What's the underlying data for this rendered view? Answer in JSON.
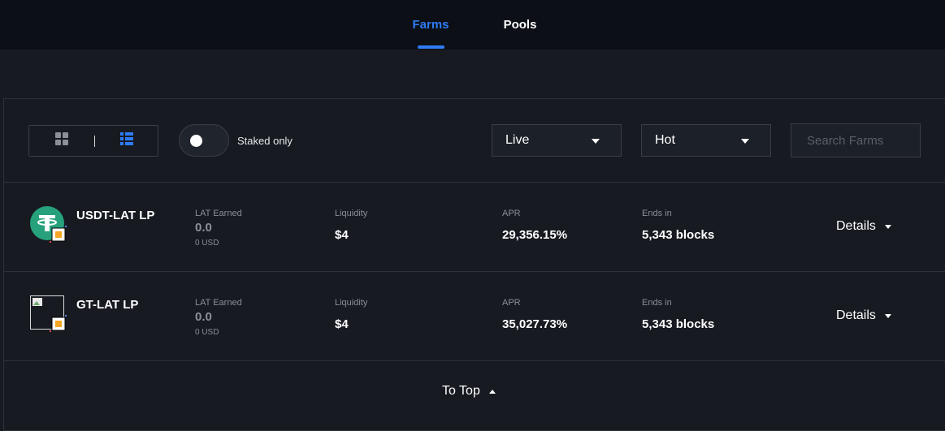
{
  "tabs": [
    {
      "label": "Farms",
      "active": true
    },
    {
      "label": "Pools",
      "active": false
    }
  ],
  "filters": {
    "view_modes": [
      "grid",
      "list"
    ],
    "active_view": "list",
    "staked_only_label": "Staked only",
    "staked_only_on": false,
    "status_value": "Live",
    "sort_value": "Hot",
    "search_placeholder": "Search Farms"
  },
  "farms": [
    {
      "pair": "USDT-LAT LP",
      "icon": "usdt-token-icon",
      "earned_label": "LAT Earned",
      "earned_value": "0.0",
      "earned_usd": "0 USD",
      "liquidity_label": "Liquidity",
      "liquidity_value": "$4",
      "apr_label": "APR",
      "apr_value": "29,356.15%",
      "ends_label": "Ends in",
      "ends_value": "5,343 blocks",
      "details_label": "Details"
    },
    {
      "pair": "GT-LAT LP",
      "icon": "broken-image-icon",
      "earned_label": "LAT Earned",
      "earned_value": "0.0",
      "earned_usd": "0 USD",
      "liquidity_label": "Liquidity",
      "liquidity_value": "$4",
      "apr_label": "APR",
      "apr_value": "35,027.73%",
      "ends_label": "Ends in",
      "ends_value": "5,343 blocks",
      "details_label": "Details"
    }
  ],
  "to_top_label": "To Top",
  "colors": {
    "accent": "#2f7bf5",
    "background": "#171a21",
    "nav_background": "#0c1016",
    "usdt_green": "#26a17b",
    "lat_badge": "#f5a623"
  }
}
